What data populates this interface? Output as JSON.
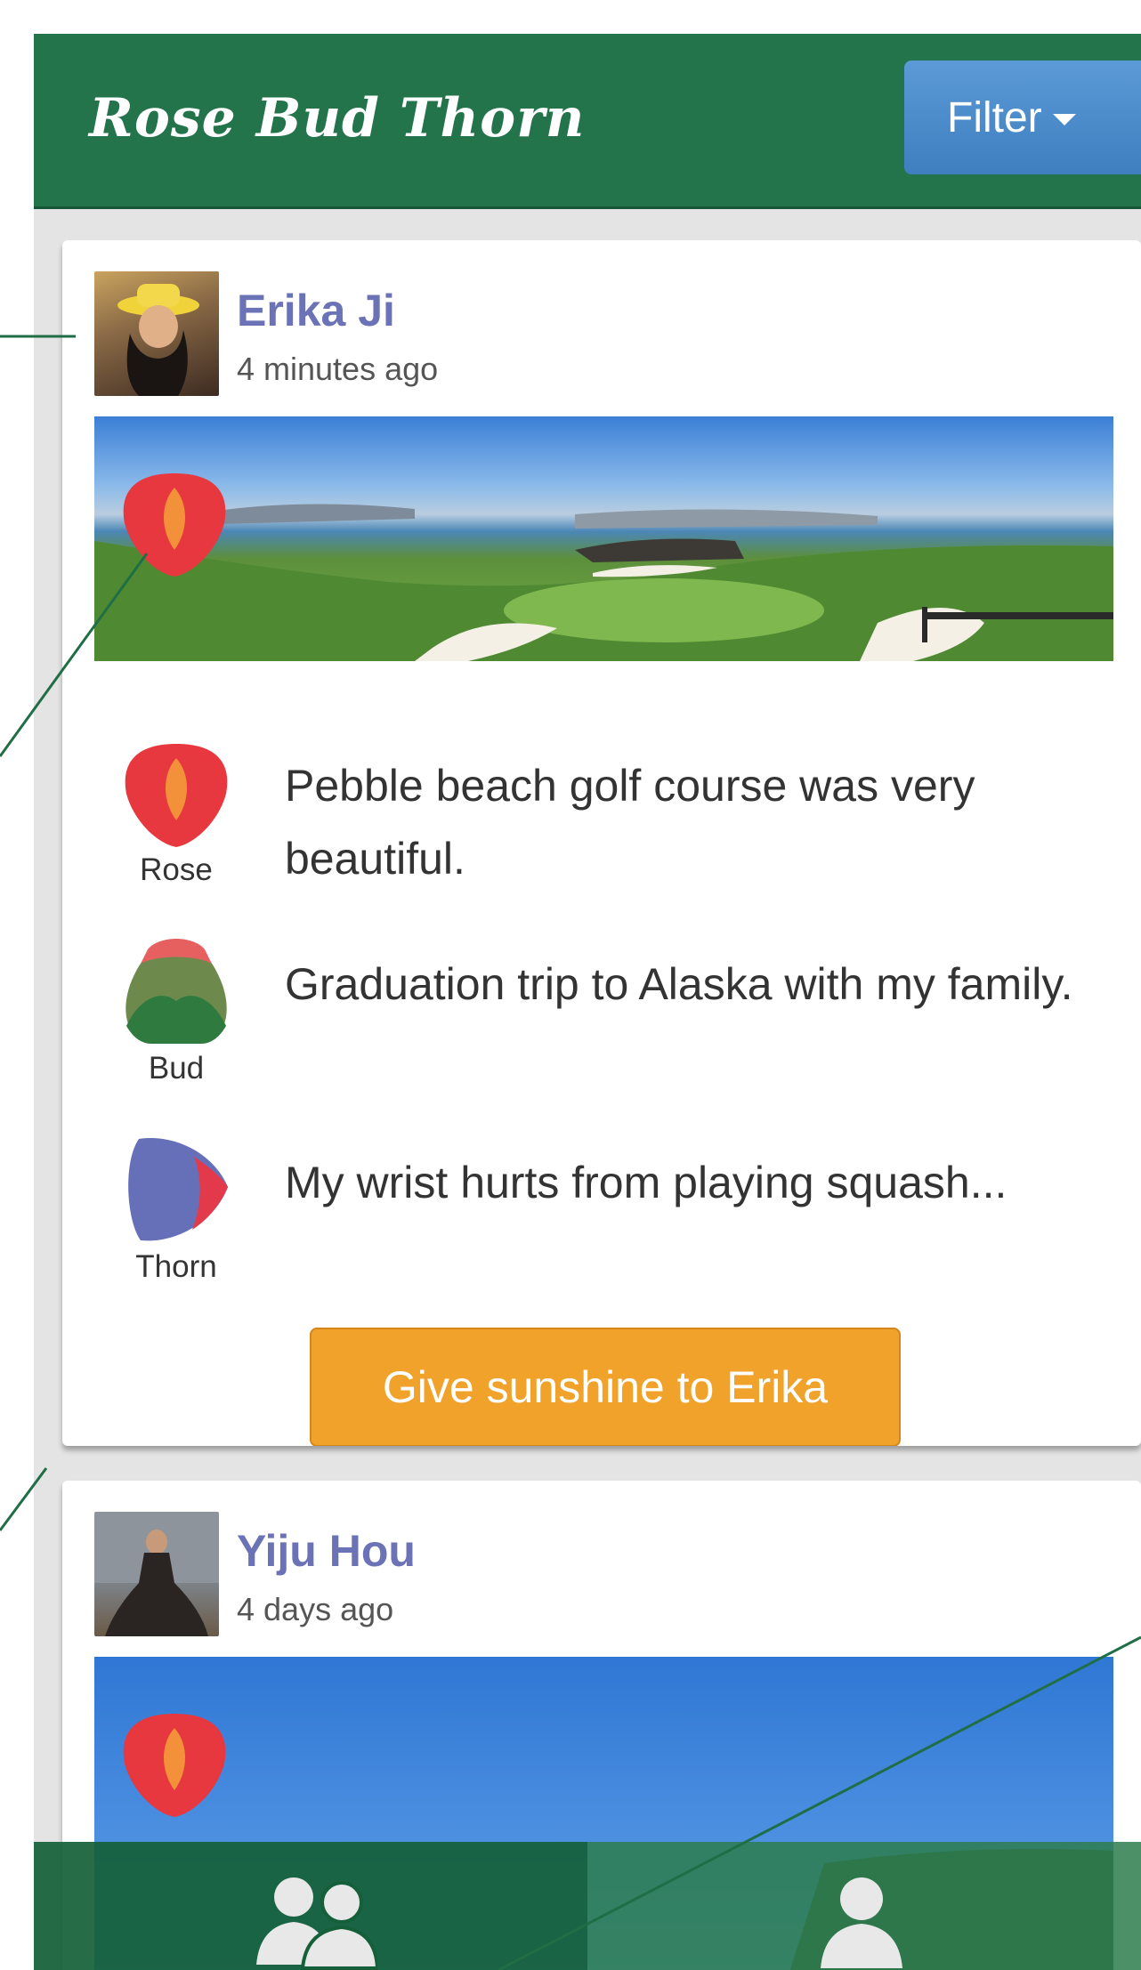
{
  "app": {
    "title": "Rose Bud Thorn",
    "filter_label": "Filter"
  },
  "posts": [
    {
      "user": "Erika Ji",
      "time": "4 minutes ago",
      "entries": [
        {
          "category": "Rose",
          "text": "Pebble beach golf course was very beautiful."
        },
        {
          "category": "Bud",
          "text": "Graduation trip to Alaska with my family."
        },
        {
          "category": "Thorn",
          "text": "My wrist hurts from playing squash..."
        }
      ],
      "action_label": "Give sunshine to Erika"
    },
    {
      "user": "Yiju Hou",
      "time": "4 days ago"
    }
  ],
  "tabs": [
    {
      "icon": "friends-icon"
    },
    {
      "icon": "profile-icon"
    }
  ],
  "colors": {
    "navbar": "#23744a",
    "filter_button": "#4a8bcb",
    "username": "#6b72b6",
    "sunshine_button": "#f0a22a",
    "rose": "#e8383f",
    "bud": "#2f7a3f",
    "thorn": "#6670b8"
  }
}
